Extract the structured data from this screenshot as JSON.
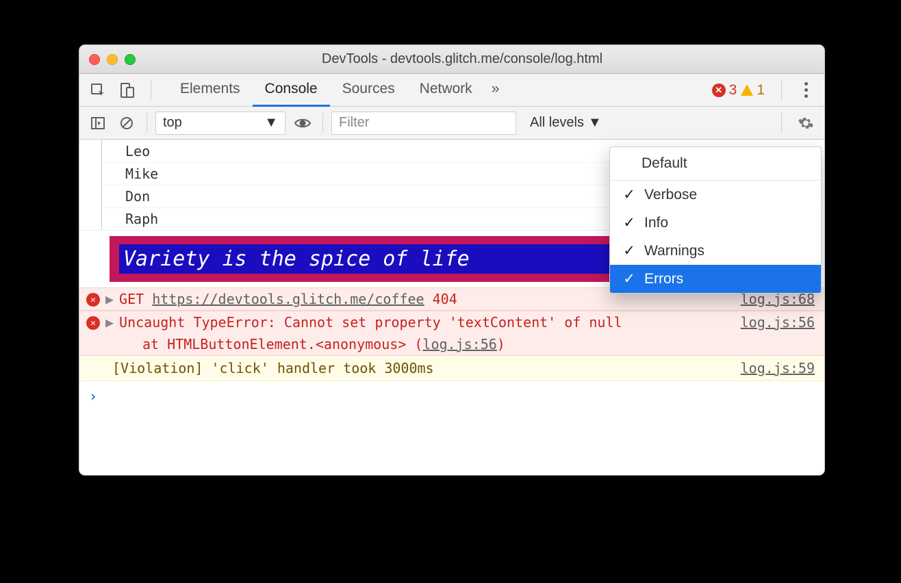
{
  "window": {
    "title": "DevTools - devtools.glitch.me/console/log.html"
  },
  "tabs": {
    "elements": "Elements",
    "console": "Console",
    "sources": "Sources",
    "network": "Network"
  },
  "toolbar": {
    "context": "top",
    "filter_placeholder": "Filter",
    "levels_label": "All levels"
  },
  "badges": {
    "errors": "3",
    "warnings": "1"
  },
  "console": {
    "tree": [
      "Leo",
      "Mike",
      "Don",
      "Raph"
    ],
    "styled_message": "Variety is the spice of life",
    "errors": [
      {
        "method": "GET",
        "url": "https://devtools.glitch.me/coffee",
        "status": "404",
        "source": "log.js:68"
      },
      {
        "message": "Uncaught TypeError: Cannot set property 'textContent' of null",
        "stack_prefix": "at HTMLButtonElement.<anonymous> (",
        "stack_link": "log.js:56",
        "stack_suffix": ")",
        "source": "log.js:56"
      }
    ],
    "violation": {
      "message": "[Violation] 'click' handler took 3000ms",
      "source": "log.js:59"
    },
    "prompt": "›"
  },
  "dropdown": {
    "header": "Default",
    "items": [
      {
        "label": "Verbose",
        "checked": true,
        "selected": false
      },
      {
        "label": "Info",
        "checked": true,
        "selected": false
      },
      {
        "label": "Warnings",
        "checked": true,
        "selected": false
      },
      {
        "label": "Errors",
        "checked": true,
        "selected": true
      }
    ]
  }
}
